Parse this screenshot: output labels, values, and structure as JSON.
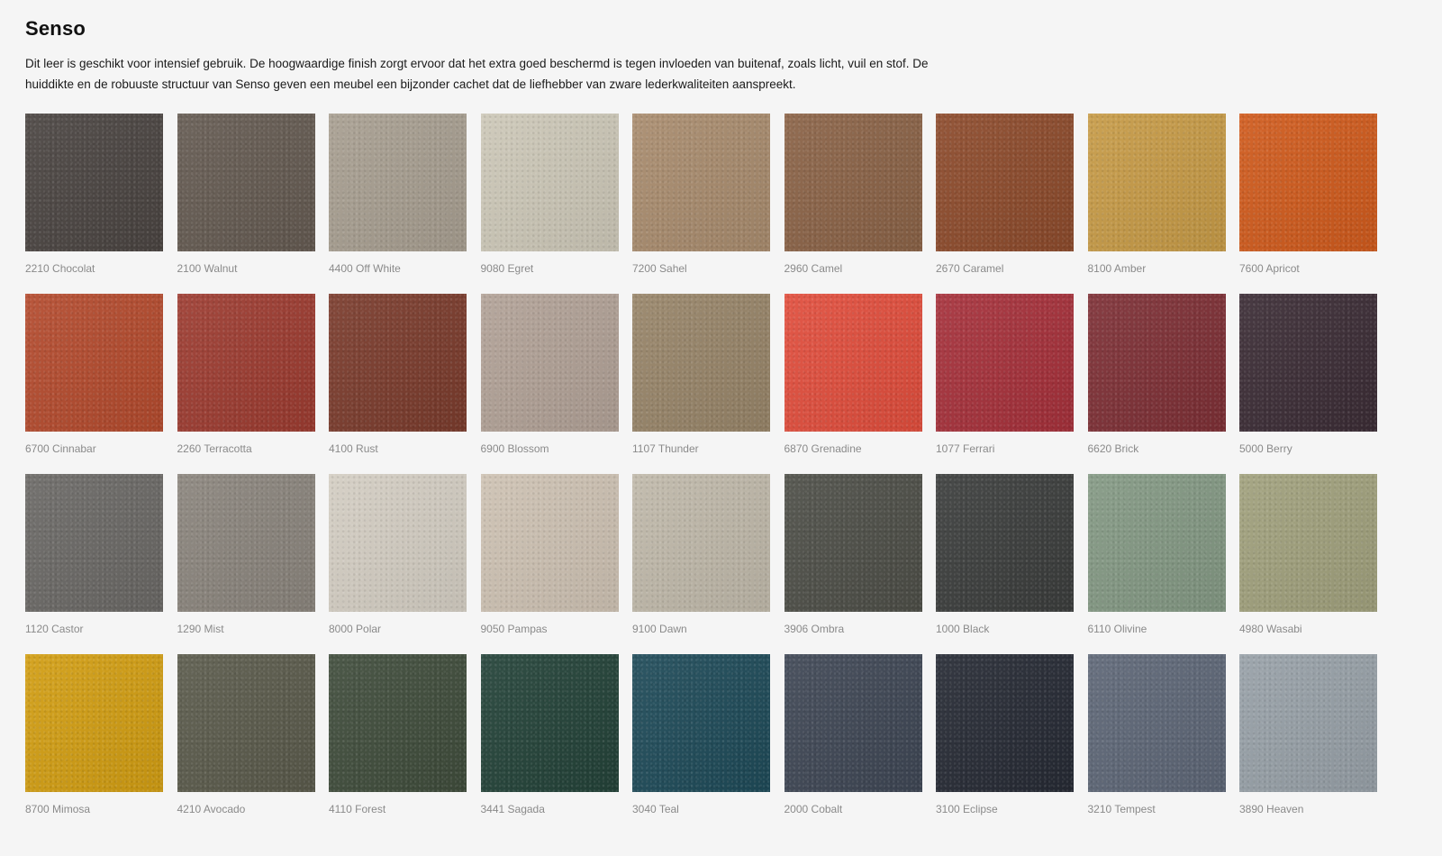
{
  "header": {
    "title": "Senso",
    "description": "Dit leer is geschikt voor intensief gebruik. De hoogwaardige finish zorgt ervoor dat het extra goed beschermd is tegen invloeden van buitenaf, zoals licht, vuil en stof. De huiddikte en de robuuste structuur van Senso geven een meubel een bijzonder cachet dat de liefhebber van zware lederkwaliteiten aanspreekt."
  },
  "swatches": [
    {
      "label": "2210 Chocolat",
      "color": "#4a4441"
    },
    {
      "label": "2100 Walnut",
      "color": "#645a51"
    },
    {
      "label": "4400 Off White",
      "color": "#a79e90"
    },
    {
      "label": "9080 Egret",
      "color": "#ccc7b7"
    },
    {
      "label": "7200 Sahel",
      "color": "#a88b6d"
    },
    {
      "label": "2960 Camel",
      "color": "#8a6246"
    },
    {
      "label": "2670 Caramel",
      "color": "#8c4a2b"
    },
    {
      "label": "8100 Amber",
      "color": "#c69a46"
    },
    {
      "label": "7600 Apricot",
      "color": "#cf5a1c"
    },
    {
      "label": "6700 Cinnabar",
      "color": "#b34a2d"
    },
    {
      "label": "2260 Terracotta",
      "color": "#9c3b30"
    },
    {
      "label": "4100 Rust",
      "color": "#7a3b2c"
    },
    {
      "label": "6900 Blossom",
      "color": "#b1a196"
    },
    {
      "label": "1107 Thunder",
      "color": "#978468"
    },
    {
      "label": "6870 Grenadine",
      "color": "#e04d3c"
    },
    {
      "label": "1077 Ferrari",
      "color": "#a5303a"
    },
    {
      "label": "6620 Brick",
      "color": "#7d2f35"
    },
    {
      "label": "5000 Berry",
      "color": "#3b2c35"
    },
    {
      "label": "1120 Castor",
      "color": "#6a6865"
    },
    {
      "label": "1290 Mist",
      "color": "#8a847c"
    },
    {
      "label": "8000 Polar",
      "color": "#d3cdc2"
    },
    {
      "label": "9050 Pampas",
      "color": "#cdc1b2"
    },
    {
      "label": "9100 Dawn",
      "color": "#bfb8a9"
    },
    {
      "label": "3906 Ombra",
      "color": "#4d4e47"
    },
    {
      "label": "1000 Black",
      "color": "#3b3d3c"
    },
    {
      "label": "6110 Olivine",
      "color": "#839883"
    },
    {
      "label": "4980 Wasabi",
      "color": "#a0a07c"
    },
    {
      "label": "8700 Mimosa",
      "color": "#d19d12"
    },
    {
      "label": "4210 Avocado",
      "color": "#5a5a4b"
    },
    {
      "label": "4110 Forest",
      "color": "#3f4c3b"
    },
    {
      "label": "3441 Sagada",
      "color": "#234238"
    },
    {
      "label": "3040 Teal",
      "color": "#1e4a58"
    },
    {
      "label": "2000 Cobalt",
      "color": "#3e4654"
    },
    {
      "label": "3100 Eclipse",
      "color": "#262a34"
    },
    {
      "label": "3210 Tempest",
      "color": "#5d6676"
    },
    {
      "label": "3890 Heaven",
      "color": "#97a0a7"
    }
  ]
}
